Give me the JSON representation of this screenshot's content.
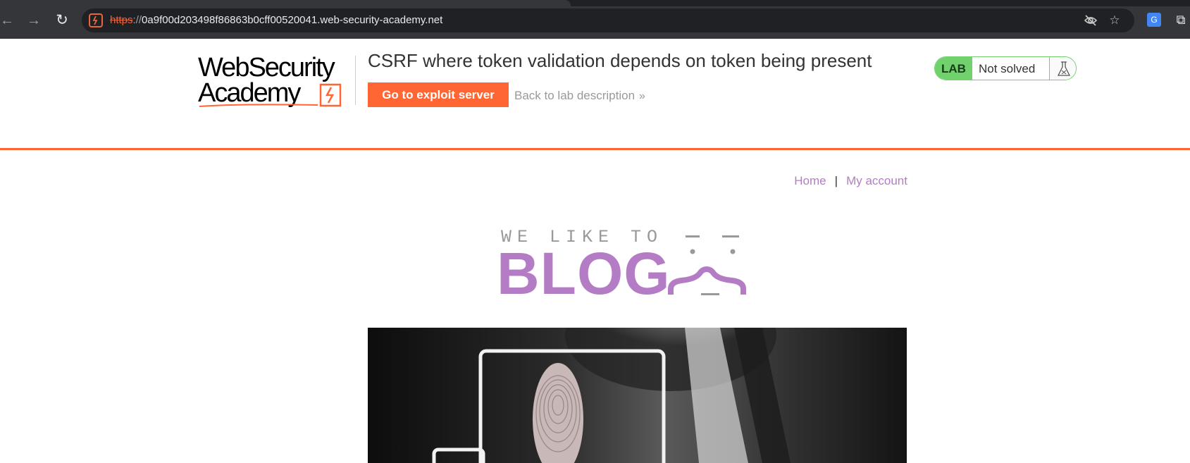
{
  "browser": {
    "url_scheme": "https",
    "url_separator": "://",
    "url_host": "0a9f00d203498f86863b0cff00520041.web-security-academy.net",
    "icons": [
      "back-arrow-icon",
      "forward-arrow-icon",
      "reload-icon",
      "site-info-icon",
      "eye-off-icon",
      "bookmark-star-icon",
      "translate-icon",
      "extensions-icon"
    ]
  },
  "lab": {
    "logo_line1": "WebSecurity",
    "logo_line2": "Academy",
    "title": "CSRF where token validation depends on token being present",
    "exploit_button": "Go to exploit server",
    "back_link": "Back to lab description",
    "back_chevron": "»",
    "status_tag": "LAB",
    "status_text": "Not solved",
    "colors": {
      "accent": "#ff6633",
      "solved_green": "#70d16d",
      "blog_purple": "#b57cc6"
    }
  },
  "blog": {
    "nav": {
      "home": "Home",
      "separator": "|",
      "my_account": "My account"
    },
    "banner_top": "WE LIKE TO",
    "banner_main": "BLOG"
  }
}
